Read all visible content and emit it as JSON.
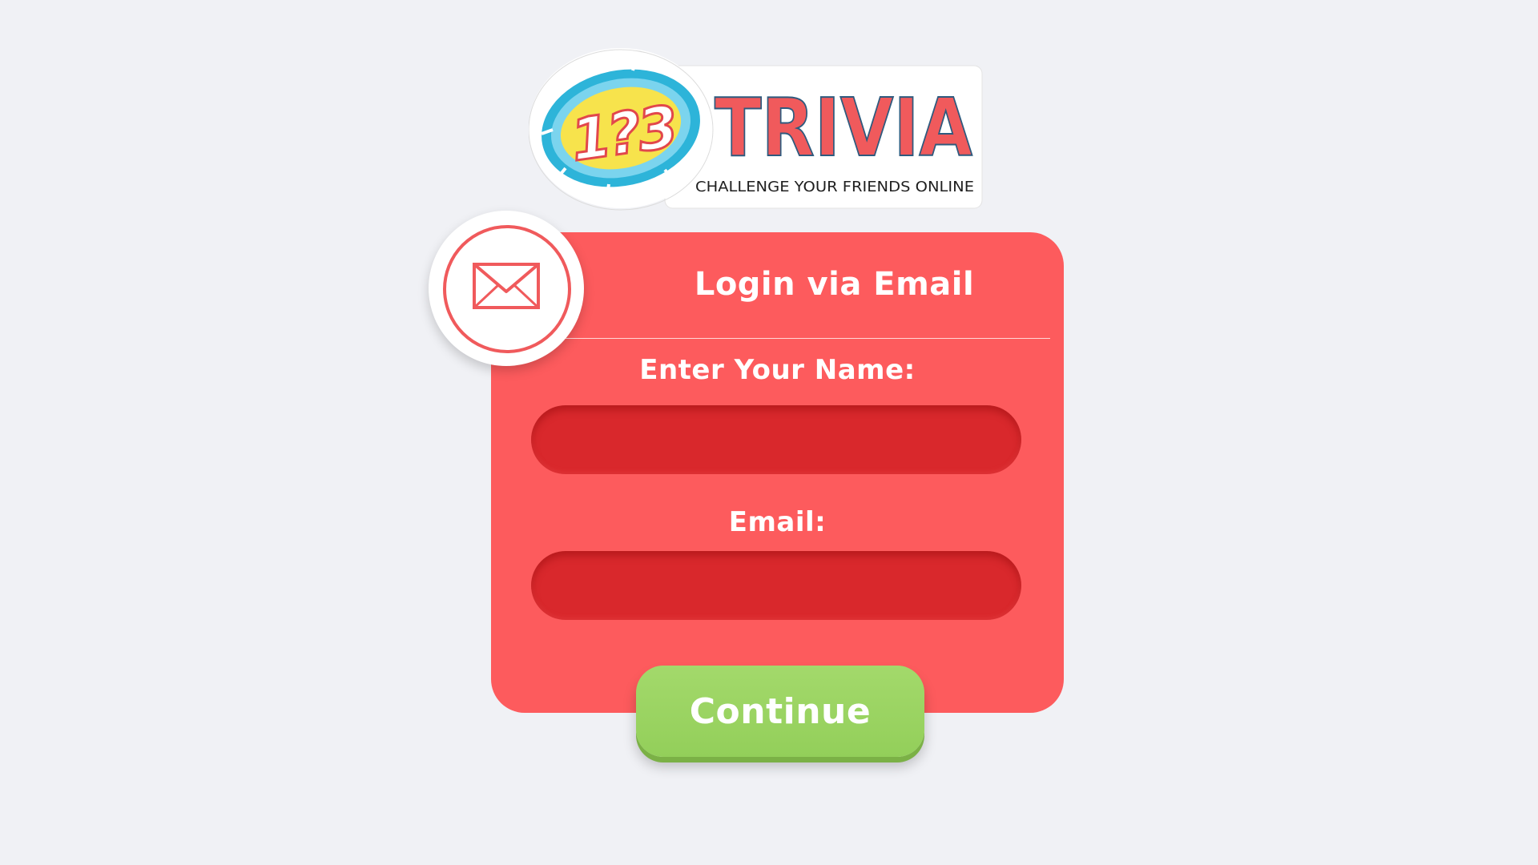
{
  "logo": {
    "numbers": "1?3",
    "brand": "TRIVIA",
    "tagline": "CHALLENGE YOUR FRIENDS ONLINE"
  },
  "login": {
    "title": "Login via Email",
    "name_label": "Enter Your Name:",
    "name_value": "",
    "email_label": "Email:",
    "email_value": "",
    "continue_label": "Continue",
    "icon": "envelope-icon"
  },
  "colors": {
    "background": "#f0f1f5",
    "card": "#fd5b5d",
    "field": "#d9282c",
    "button": "#9ed566",
    "brand_red": "#f05a5c",
    "logo_yellow": "#f7e34c",
    "logo_blue": "#2db4d9"
  }
}
